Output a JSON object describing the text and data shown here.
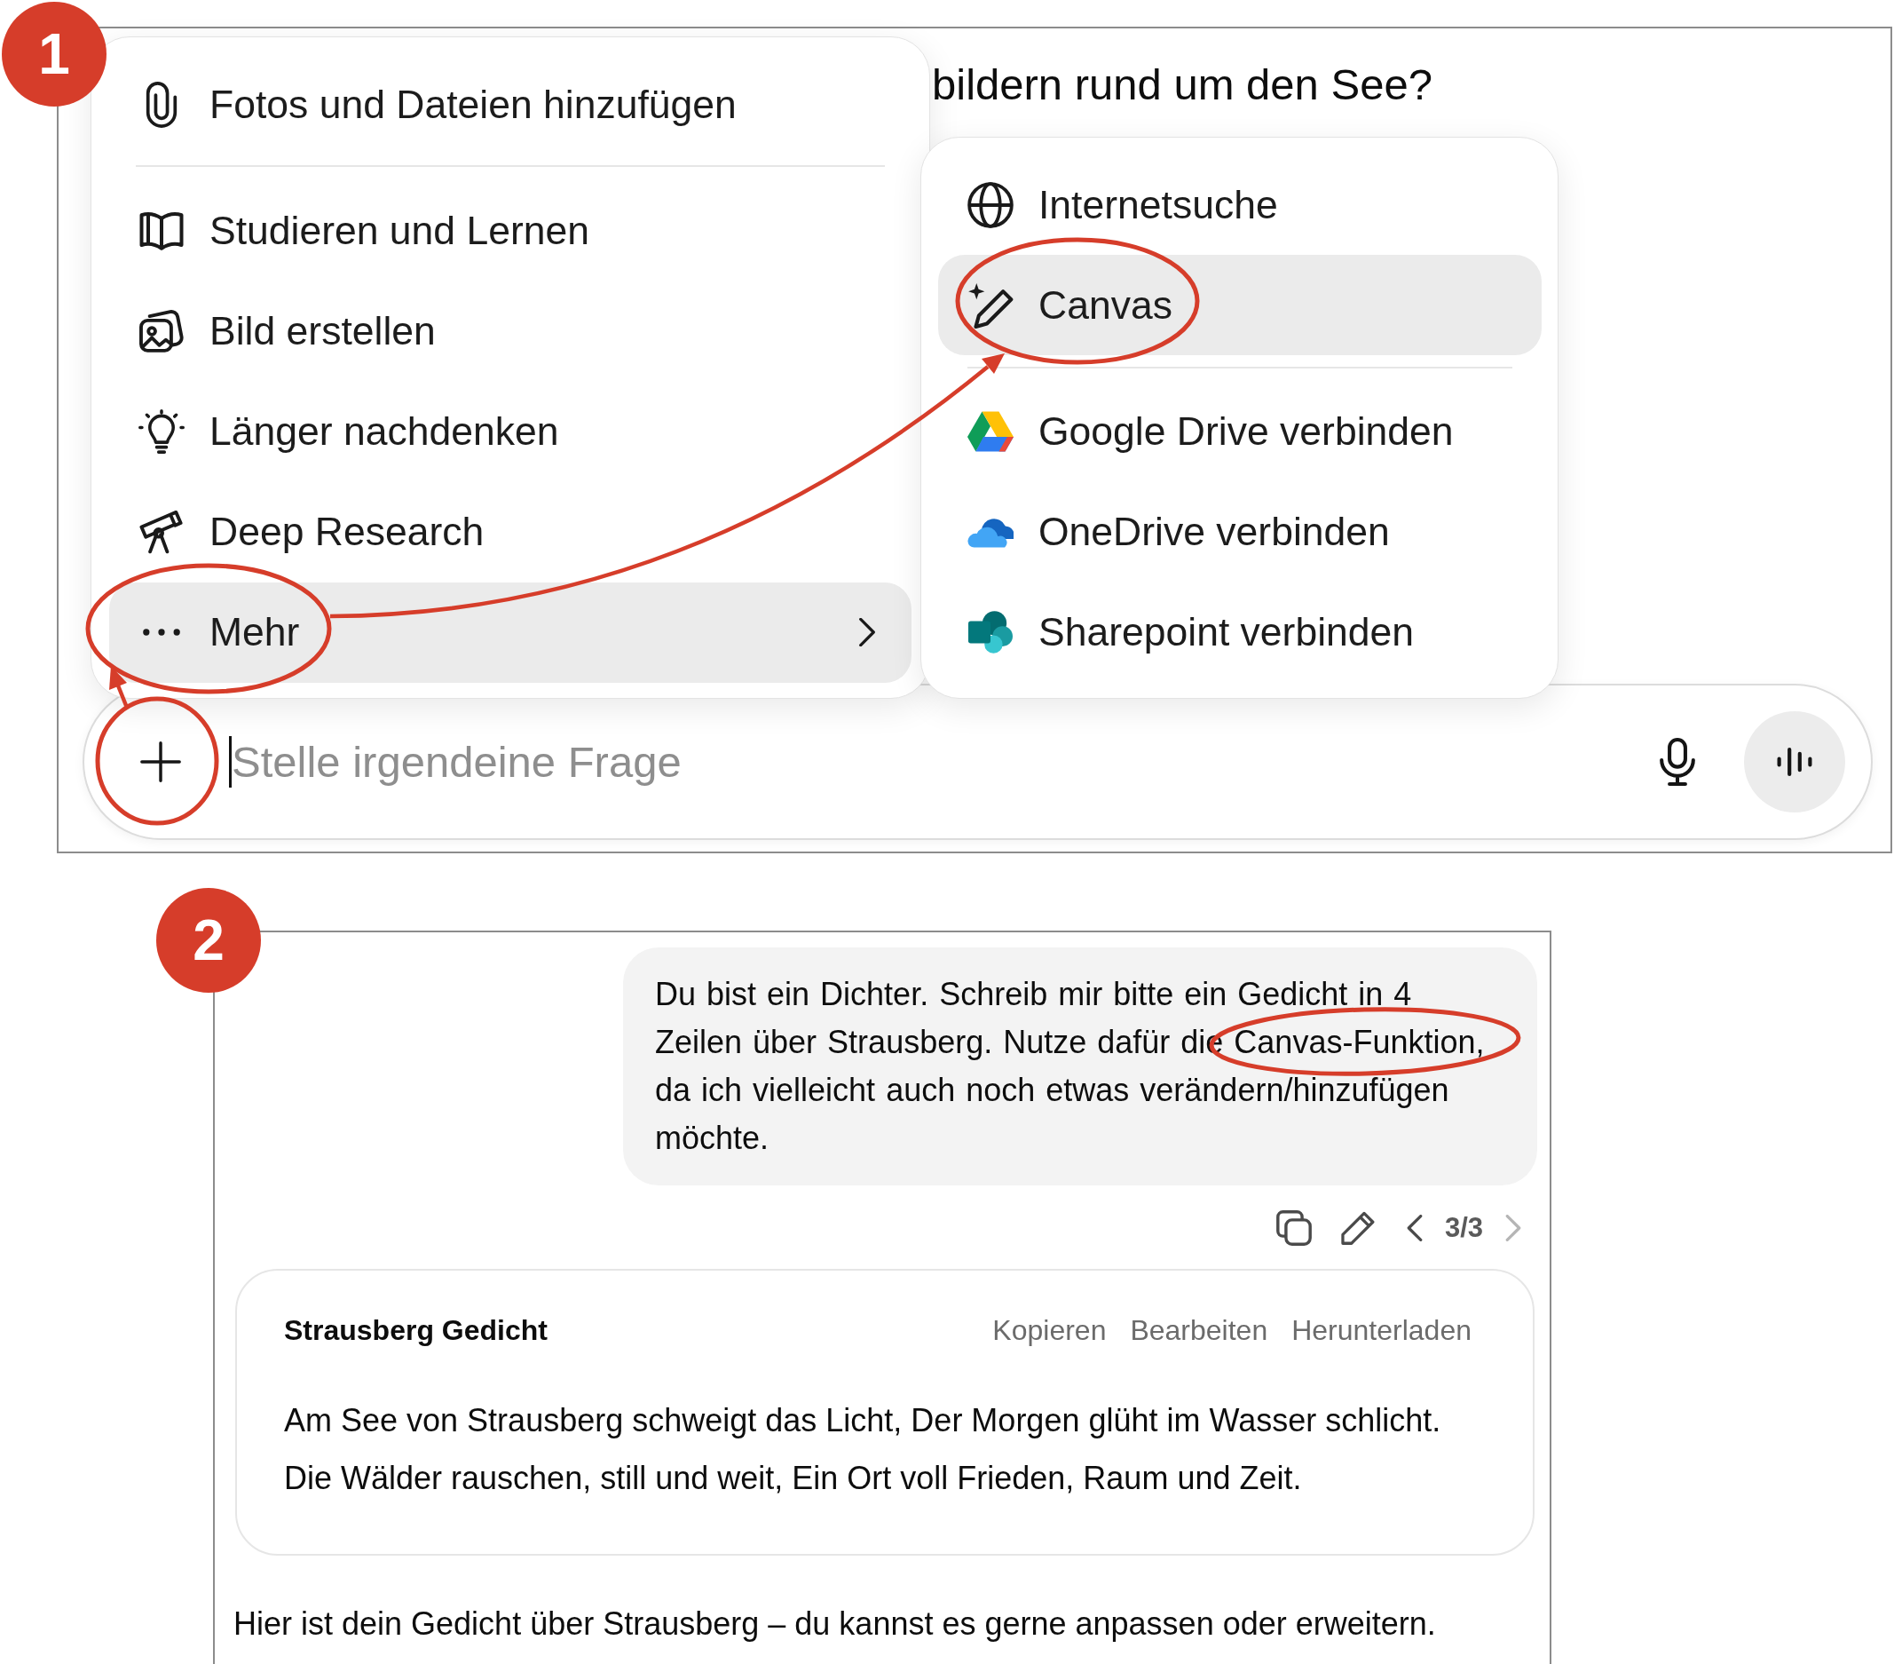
{
  "panel_1": {
    "step_badge": "1",
    "chat_text": "bildern rund um den See?",
    "menu": {
      "groups": [
        {
          "items": [
            {
              "label": "Fotos und Dateien hinzufügen",
              "selected": false,
              "submenu": false
            }
          ]
        },
        {
          "items": [
            {
              "label": "Studieren und Lernen",
              "selected": false,
              "submenu": false
            },
            {
              "label": "Bild erstellen",
              "selected": false,
              "submenu": false
            },
            {
              "label": "Länger nachdenken",
              "selected": false,
              "submenu": false
            },
            {
              "label": "Deep Research",
              "selected": false,
              "submenu": false
            },
            {
              "label": "Mehr",
              "selected": true,
              "submenu": true
            }
          ]
        }
      ]
    },
    "submenu": {
      "groups": [
        {
          "items": [
            {
              "label": "Internetsuche",
              "selected": false
            },
            {
              "label": "Canvas",
              "selected": true
            }
          ]
        },
        {
          "items": [
            {
              "label": "Google Drive verbinden",
              "selected": false
            },
            {
              "label": "OneDrive verbinden",
              "selected": false
            },
            {
              "label": "Sharepoint verbinden",
              "selected": false
            }
          ]
        }
      ]
    },
    "composer": {
      "placeholder": "Stelle irgendeine Frage"
    }
  },
  "panel_2": {
    "step_badge": "2",
    "user_message": "Du bist ein Dichter. Schreib mir bitte ein Gedicht in 4 Zeilen über Strausberg. Nutze dafür die Canvas-Funktion, da ich vielleicht auch noch etwas verändern/hinzufügen möchte.",
    "message_actions": {
      "pager": "3/3",
      "prev_disabled": false,
      "next_disabled": true
    },
    "canvas_card": {
      "title": "Strausberg Gedicht",
      "actions": [
        "Kopieren",
        "Bearbeiten",
        "Herunterladen"
      ],
      "lines": [
        "Am See von Strausberg schweigt das Licht, Der Morgen glüht im Wasser schlicht.",
        "Die Wälder rauschen, still und weit, Ein Ort voll Frieden, Raum und Zeit."
      ]
    },
    "assistant_message": "Hier ist dein Gedicht über Strausberg – du kannst es gerne anpassen oder erweitern."
  }
}
